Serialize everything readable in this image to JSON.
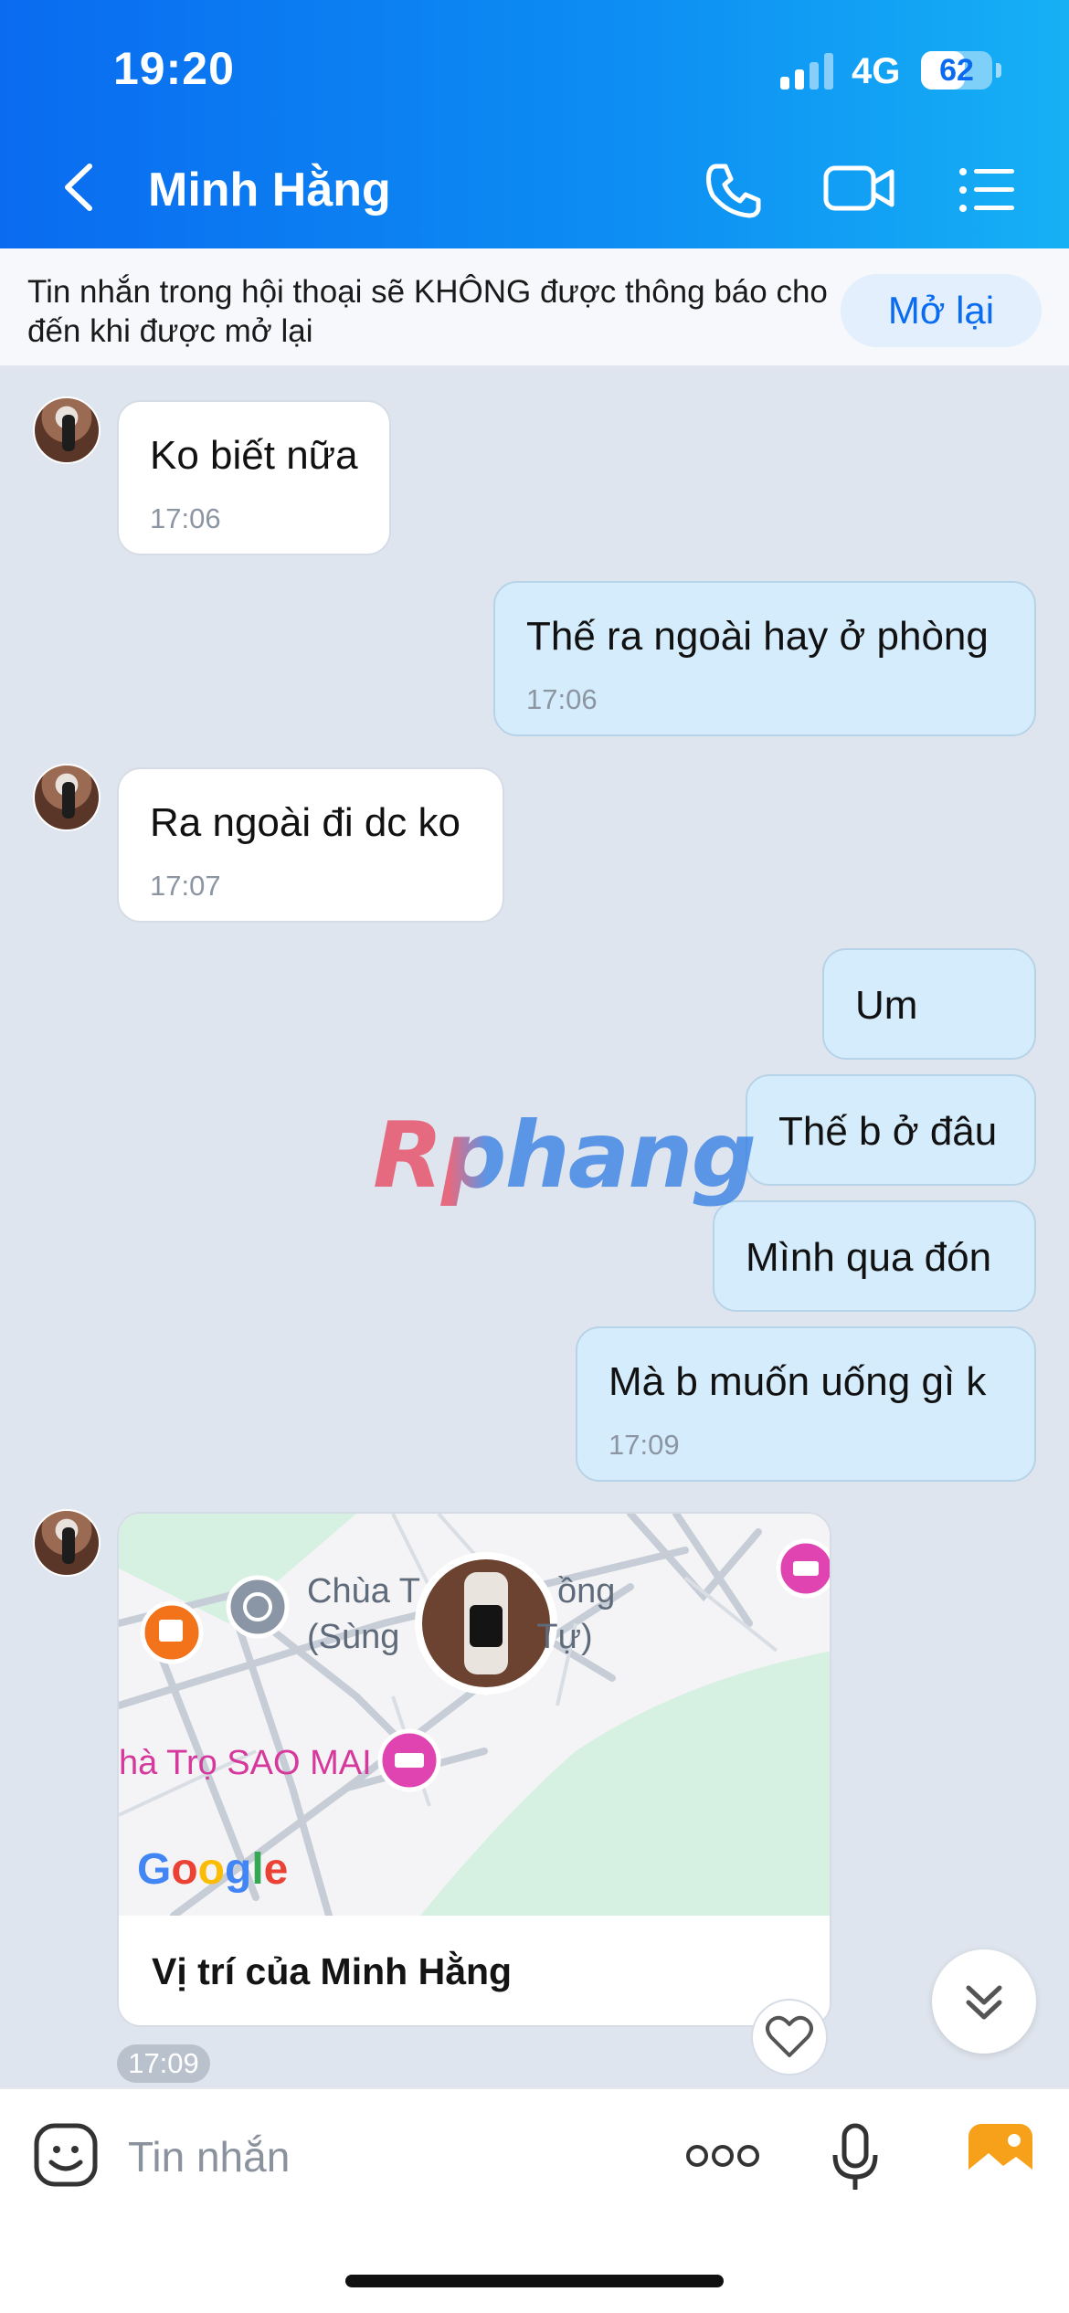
{
  "status_bar": {
    "time": "19:20",
    "network": "4G",
    "battery": "62"
  },
  "header": {
    "title": "Minh Hằng"
  },
  "banner": {
    "text": "Tin nhắn trong hội thoại sẽ KHÔNG được thông báo cho đến khi được mở lại",
    "button": "Mở lại"
  },
  "messages": [
    {
      "text": "Ko biết nữa",
      "time": "17:06"
    },
    {
      "text": "Thế ra ngoài hay ở phòng",
      "time": "17:06"
    },
    {
      "text": "Ra ngoài đi dc ko",
      "time": "17:07"
    },
    {
      "text": "Um"
    },
    {
      "text": "Thế b ở đâu"
    },
    {
      "text": "Mình qua đón"
    },
    {
      "text": "Mà b muốn uống gì k",
      "time": "17:09"
    }
  ],
  "watermark": "Rphang",
  "location": {
    "map_labels": {
      "chua_line1": "Chùa T",
      "chua_line1_end": "ồng",
      "chua_line2": "(Sùng",
      "chua_line2_end": "Tự)",
      "tro": "hà Trọ SAO MAI"
    },
    "google": "Google",
    "title": "Vị trí của Minh Hằng",
    "time": "17:09"
  },
  "input": {
    "placeholder": "Tin nhắn"
  },
  "icons": [
    "back-icon",
    "phone-icon",
    "video-call-icon",
    "menu-list-icon",
    "heart-icon",
    "chevron-double-down-icon",
    "emoji-icon",
    "more-dots-icon",
    "microphone-icon",
    "gallery-icon"
  ]
}
